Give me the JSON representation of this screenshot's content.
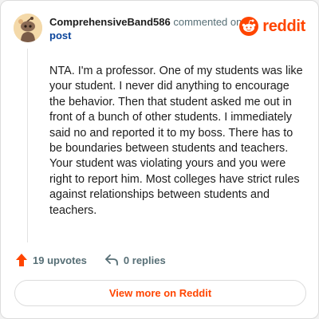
{
  "header": {
    "author": "ComprehensiveBand586",
    "action_text": "commented on",
    "post_link": "post"
  },
  "brand": {
    "name": "reddit",
    "icon": "reddit-snoo-icon",
    "color": "#ff4500"
  },
  "comment": {
    "body": "NTA. I'm a professor. One of my students was like your student. I never did anything to encourage the behavior. Then that student asked me out in front of a bunch of other students. I immediately said no and reported it to my boss. There has to be boundaries between students and teachers. Your student was violating yours and you were right to report him. Most colleges have strict rules against relationships between students and teachers."
  },
  "actions": {
    "upvotes": "19 upvotes",
    "replies": "0 replies",
    "upvote_icon": "upvote-arrow-icon",
    "reply_icon": "reply-arrow-icon"
  },
  "footer": {
    "view_label": "View more on Reddit"
  }
}
